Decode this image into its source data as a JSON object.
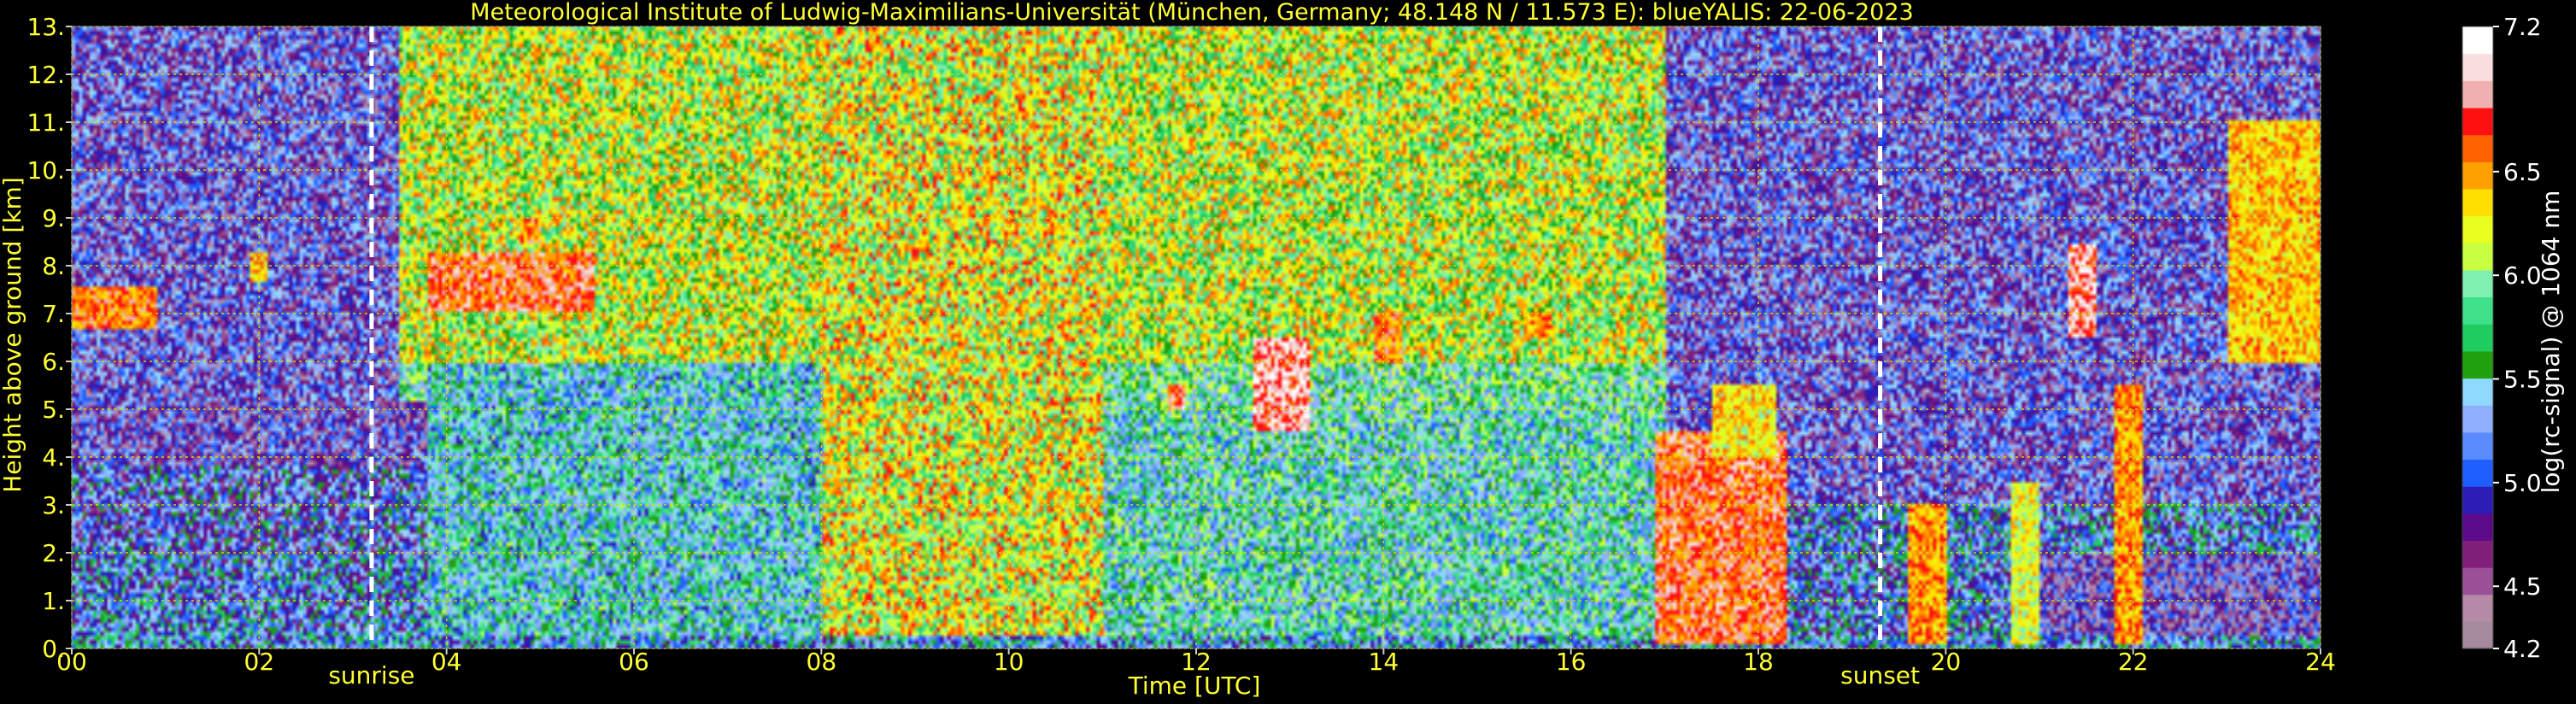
{
  "chart_data": {
    "type": "heatmap",
    "title": "Meteorological Institute of Ludwig-Maximilians-Universität (München, Germany; 48.148 N / 11.573 E):    blueYALIS: 22-06-2023",
    "xlabel": "Time [UTC]",
    "ylabel": "Height above ground [km]",
    "xlim": [
      0,
      24
    ],
    "ylim": [
      0,
      13
    ],
    "grid": true,
    "x_ticks": [
      "00",
      "02",
      "04",
      "06",
      "08",
      "10",
      "12",
      "14",
      "16",
      "18",
      "20",
      "22",
      "24"
    ],
    "y_ticks": [
      "0.",
      "1.",
      "2.",
      "3.",
      "4.",
      "5.",
      "6.",
      "7.",
      "8.",
      "9.",
      "10.",
      "11.",
      "12.",
      "13."
    ],
    "markers": [
      {
        "label": "sunrise",
        "x": 3.2
      },
      {
        "label": "sunset",
        "x": 19.3
      }
    ],
    "colorbar": {
      "label": "log(rc-signal) @ 1064 nm",
      "range": [
        4.2,
        7.2
      ],
      "ticks": [
        "7.2",
        "6.5",
        "6.0",
        "5.5",
        "5.0",
        "4.5",
        "4.2"
      ]
    },
    "layers": [
      {
        "t0": 0,
        "t1": 24,
        "h0": 0.0,
        "h1": 0.4,
        "value": 5.3
      },
      {
        "t0": 0,
        "t1": 3.8,
        "h0": 0.4,
        "h1": 2.0,
        "value": 5.2
      },
      {
        "t0": 0,
        "t1": 3.8,
        "h0": 2.0,
        "h1": 3.8,
        "value": 5.1
      },
      {
        "t0": 0,
        "t1": 3.8,
        "h0": 3.8,
        "h1": 5.2,
        "value": 4.9
      },
      {
        "t0": 3.8,
        "t1": 8.0,
        "h0": 0.3,
        "h1": 6.0,
        "value": 5.5
      },
      {
        "t0": 8.0,
        "t1": 11.0,
        "h0": 0.3,
        "h1": 13.0,
        "value": 6.2
      },
      {
        "t0": 11.0,
        "t1": 17.0,
        "h0": 0.3,
        "h1": 5.0,
        "value": 5.6
      },
      {
        "t0": 17.0,
        "t1": 24.0,
        "h0": 0.3,
        "h1": 3.0,
        "value": 5.2
      },
      {
        "t0": 21.0,
        "t1": 24.0,
        "h0": 0.3,
        "h1": 2.0,
        "value": 4.8
      }
    ],
    "clouds": [
      {
        "t0": 0.0,
        "t1": 0.9,
        "h0": 6.7,
        "h1": 7.6,
        "value": 6.6
      },
      {
        "t0": 1.9,
        "t1": 2.1,
        "h0": 7.7,
        "h1": 8.3,
        "value": 6.4
      },
      {
        "t0": 3.8,
        "t1": 5.6,
        "h0": 7.0,
        "h1": 8.3,
        "value": 6.7
      },
      {
        "t0": 4.8,
        "t1": 5.0,
        "h0": 8.5,
        "h1": 9.0,
        "value": 6.6
      },
      {
        "t0": 12.6,
        "t1": 13.2,
        "h0": 4.5,
        "h1": 6.5,
        "value": 6.9
      },
      {
        "t0": 11.7,
        "t1": 11.9,
        "h0": 5.0,
        "h1": 5.5,
        "value": 6.8
      },
      {
        "t0": 13.9,
        "t1": 14.2,
        "h0": 6.0,
        "h1": 7.0,
        "value": 6.6
      },
      {
        "t0": 15.5,
        "t1": 15.8,
        "h0": 6.5,
        "h1": 7.0,
        "value": 6.5
      },
      {
        "t0": 16.9,
        "t1": 18.3,
        "h0": 0.1,
        "h1": 4.5,
        "value": 6.7
      },
      {
        "t0": 17.5,
        "t1": 18.2,
        "h0": 4.0,
        "h1": 5.5,
        "value": 6.3
      },
      {
        "t0": 19.6,
        "t1": 20.0,
        "h0": 0.1,
        "h1": 3.0,
        "value": 6.5
      },
      {
        "t0": 20.7,
        "t1": 21.0,
        "h0": 0.1,
        "h1": 3.5,
        "value": 6.2
      },
      {
        "t0": 21.3,
        "t1": 21.6,
        "h0": 6.5,
        "h1": 8.5,
        "value": 6.9
      },
      {
        "t0": 21.8,
        "t1": 22.1,
        "h0": 0.1,
        "h1": 5.5,
        "value": 6.5
      },
      {
        "t0": 23.0,
        "t1": 24.0,
        "h0": 6.0,
        "h1": 11.0,
        "value": 6.4
      }
    ],
    "colorscale": [
      "#a58a9b",
      "#b48aa6",
      "#9b4f97",
      "#7f1f7a",
      "#5b0a8a",
      "#2b1db5",
      "#1f5eff",
      "#5a8cff",
      "#8fb0ff",
      "#8fd9ff",
      "#1fa00f",
      "#1fcc60",
      "#3fe08a",
      "#7ff0b0",
      "#c8ff40",
      "#e8ff20",
      "#ffe000",
      "#ffa000",
      "#ff6000",
      "#ff1010",
      "#f0b0b0",
      "#f8dede",
      "#ffffff"
    ],
    "colors": {
      "text": "#ffff33",
      "grid": "#d8d800",
      "background": "#000000",
      "marker": "#ffffff",
      "colorbar_text": "#ffffff"
    }
  }
}
